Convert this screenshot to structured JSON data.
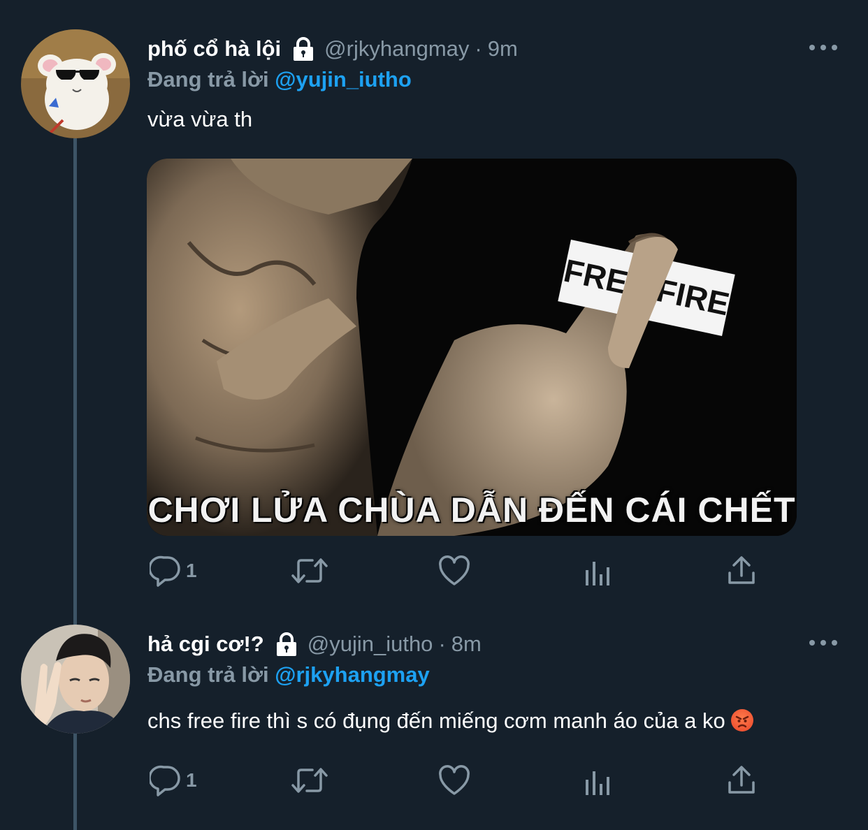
{
  "colors": {
    "background": "#15202b",
    "secondary_text": "#8899a6",
    "link": "#1da1f2",
    "thread_line": "#3d5466"
  },
  "tweets": [
    {
      "display_name": "phố cổ hà lội",
      "handle": "@rjkyhangmay",
      "separator": "·",
      "time": "9m",
      "reply_prefix": "Đang trả lời",
      "reply_to": "@yujin_iutho",
      "text": "vừa vừa th",
      "image_caption": "CHƠI LỬA CHÙA DẪN ĐẾN CÁI CHẾT",
      "image_logo": "FREE FIRE",
      "reply_count": "1",
      "icons": [
        "lock-icon",
        "more-icon",
        "reply-icon",
        "retweet-icon",
        "like-icon",
        "analytics-icon",
        "share-icon"
      ]
    },
    {
      "display_name": "hả cgi cơ!?",
      "handle": "@yujin_iutho",
      "separator": "·",
      "time": "8m",
      "reply_prefix": "Đang trả lời",
      "reply_to": "@rjkyhangmay",
      "text": "chs free fire thì s có đụng đến miếng cơm manh áo của a ko",
      "emoji": "angry-face-emoji",
      "reply_count": "1",
      "icons": [
        "lock-icon",
        "more-icon",
        "reply-icon",
        "retweet-icon",
        "like-icon",
        "analytics-icon",
        "share-icon"
      ]
    }
  ]
}
